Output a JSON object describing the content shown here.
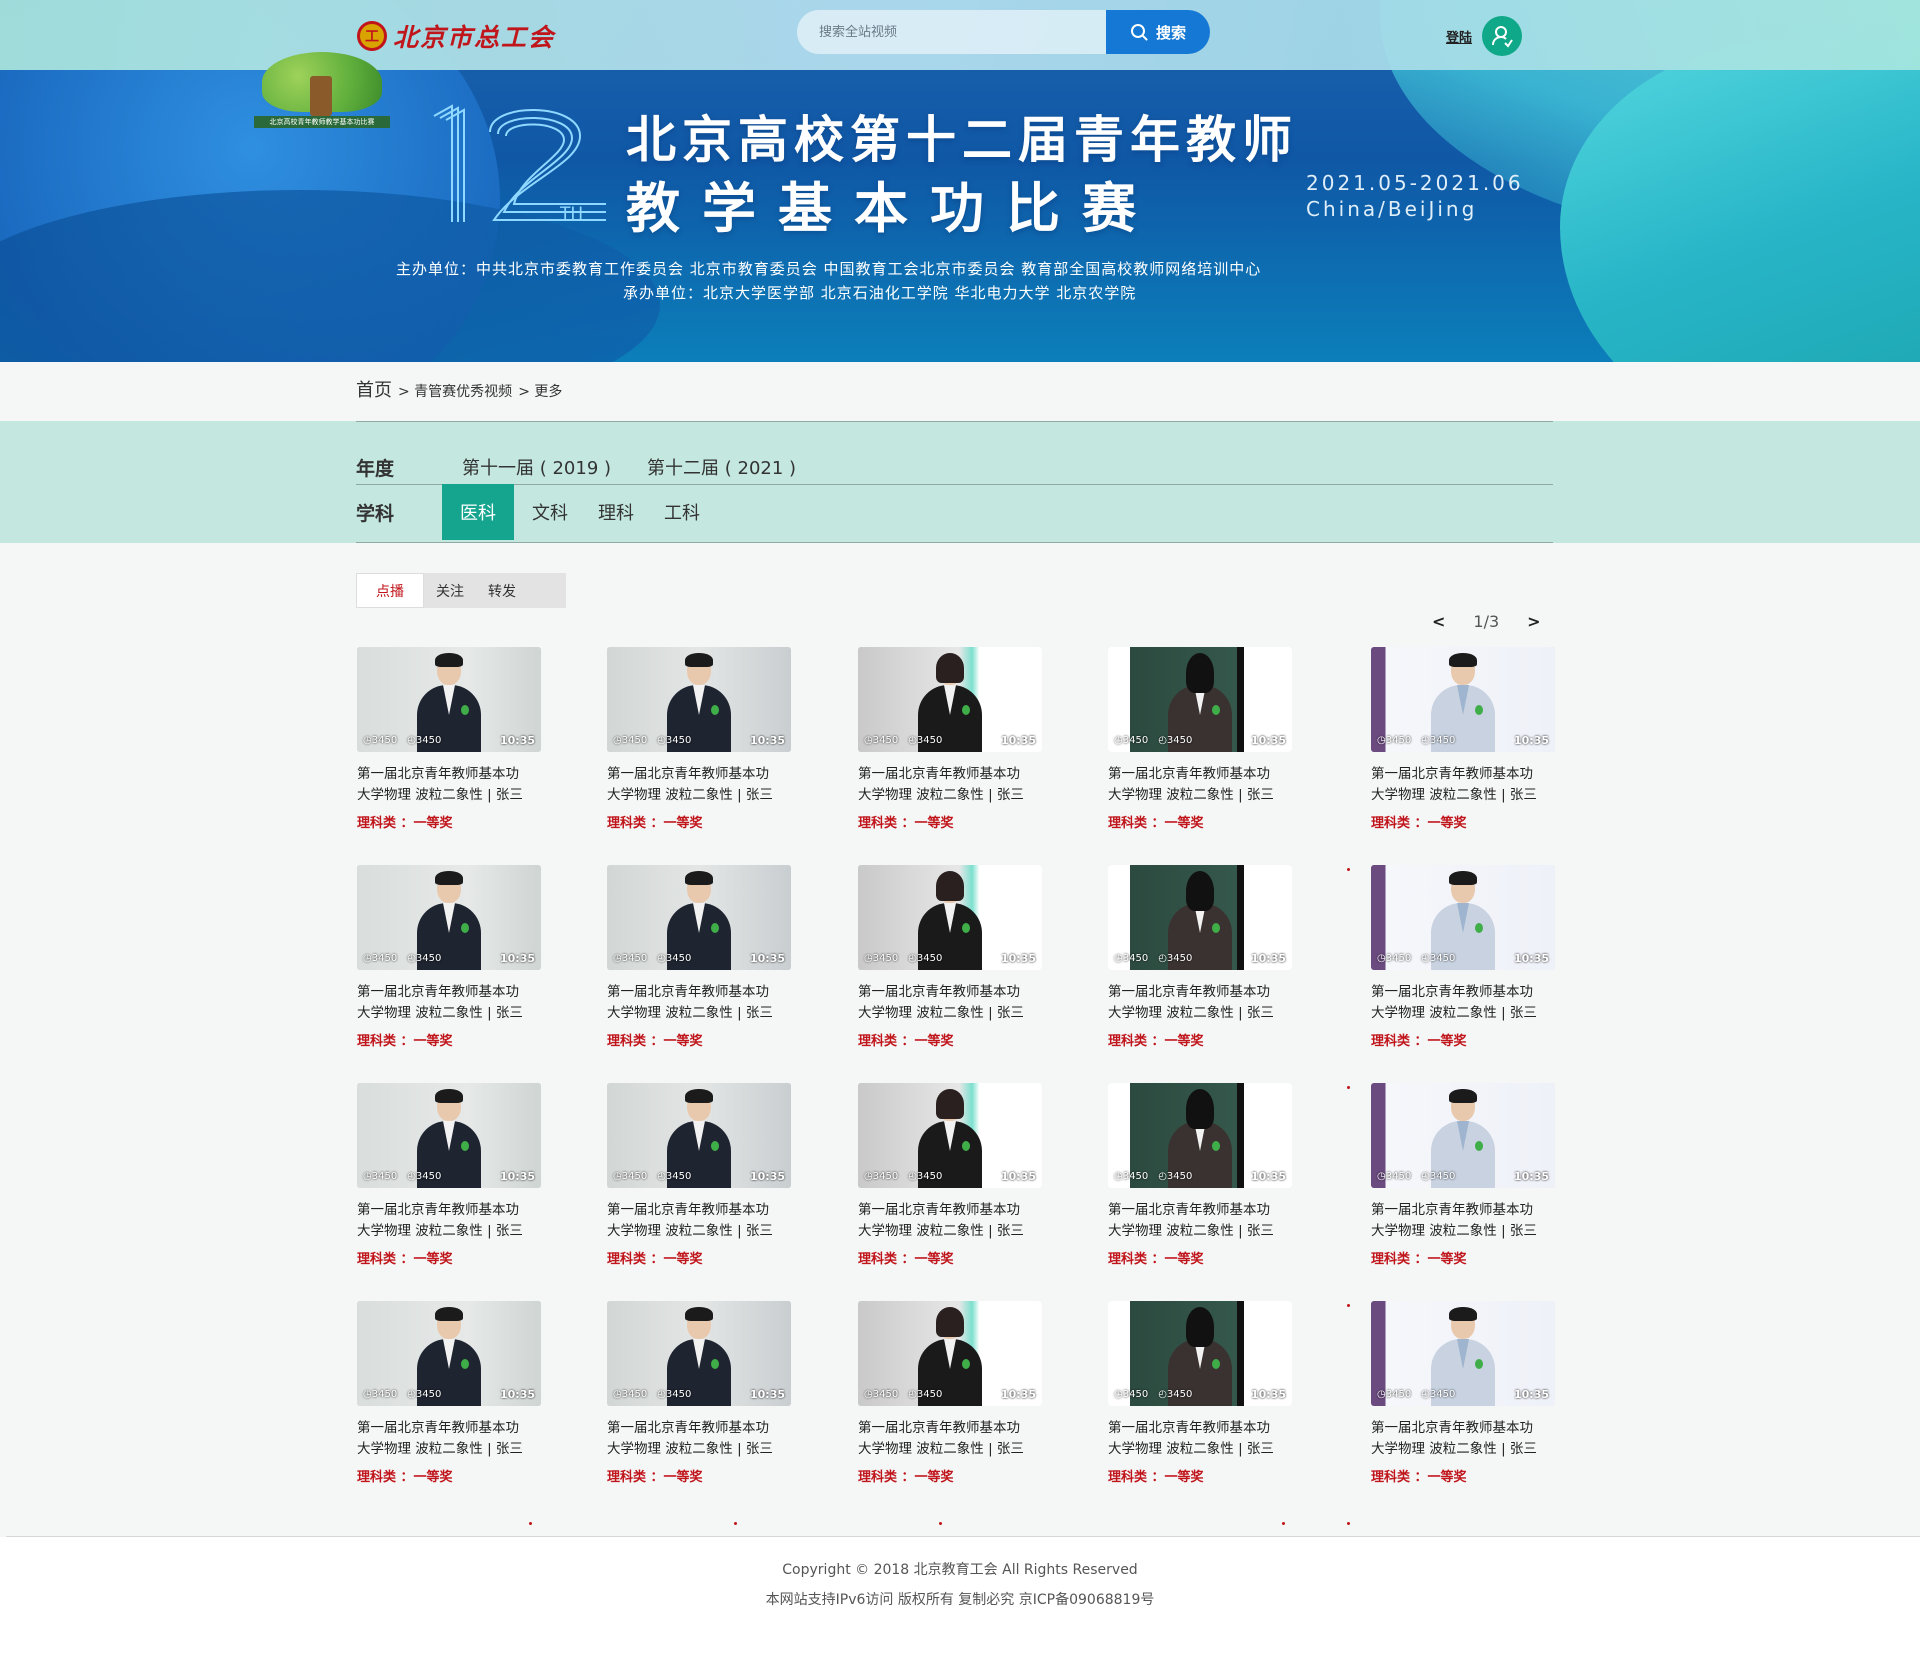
{
  "header": {
    "logo_text": "北京市总工会",
    "logo_mark": "工",
    "search_placeholder": "搜索全站视频",
    "search_button": "搜索",
    "login_label": "登陆"
  },
  "banner": {
    "sublogo_caption": "北京高校青年教师教学基本功比赛",
    "edition_number": "12",
    "edition_suffix": "TH",
    "title_line1": "北京高校第十二届青年教师",
    "title_line2": "教学基本功比赛",
    "date_range": "2021.05-2021.06",
    "location": "China/BeiJing",
    "organizers": "主办单位：中共北京市委教育工作委员会  北京市教育委员会  中国教育工会北京市委员会  教育部全国高校教师网络培训中心",
    "co_organizers": "承办单位：北京大学医学部  北京石油化工学院  华北电力大学  北京农学院"
  },
  "breadcrumb": {
    "home": "首页",
    "level1": "> 青管赛优秀视频",
    "level2": "> 更多"
  },
  "filters": {
    "year_label": "年度",
    "years": [
      "第十一届 ( 2019 )",
      "第十二届 ( 2021 )"
    ],
    "subject_label": "学科",
    "subjects": [
      "医科",
      "文科",
      "理科",
      "工科"
    ],
    "active_subject": "医科"
  },
  "sort_tabs": {
    "items": [
      "点播",
      "关注",
      "转发"
    ],
    "active": "点播"
  },
  "pagination": {
    "prev": "<",
    "page": "1/3",
    "next": ">"
  },
  "video_card": {
    "title_line1": "第一届北京青年教师基本功",
    "title_line2": "大学物理 波粒二象性 | 张三",
    "award": "理科类 ：一等奖",
    "views": "3450",
    "likes": "3450",
    "duration": "10:35"
  },
  "video_styles": [
    "t-gray",
    "t-gray2",
    "t-white",
    "t-board",
    "t-lab"
  ],
  "footer": {
    "copyright": "Copyright © 2018 北京教育工会  All Rights Reserved",
    "icp": "本网站支持IPv6访问 版权所有 复制必究 京ICP备09068819号"
  },
  "colors": {
    "primary_blue": "#1478d4",
    "teal": "#15a58f",
    "filter_bg": "#c4e8e0",
    "award_red": "#c0151b"
  }
}
